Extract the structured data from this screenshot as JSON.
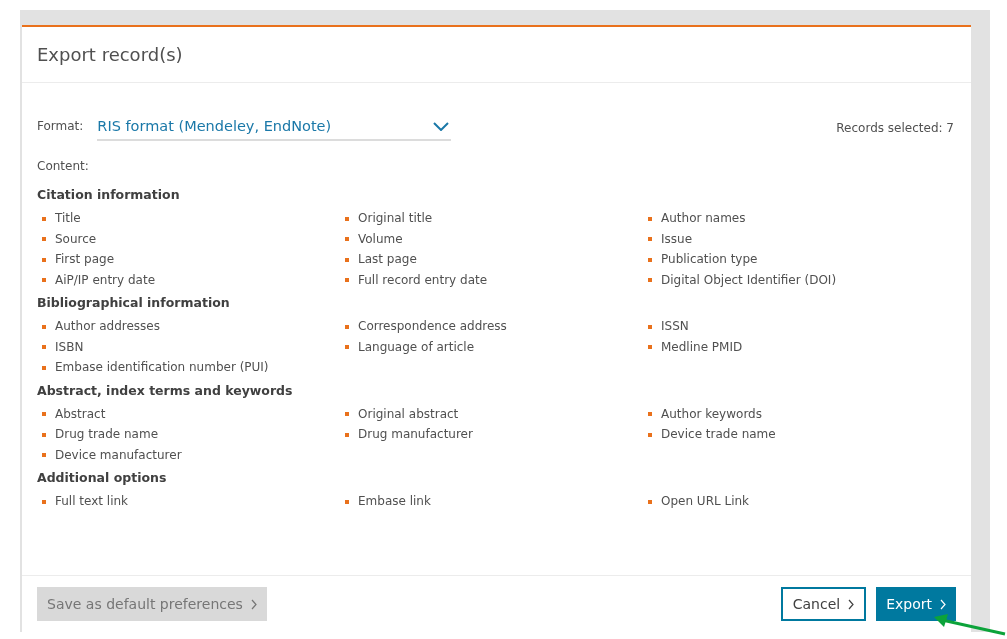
{
  "dialog": {
    "title": "Export record(s)",
    "format_label": "Format:",
    "format_value": "RIS format (Mendeley, EndNote)",
    "records_selected": "Records selected: 7",
    "content_label": "Content:",
    "sections": [
      {
        "heading": "Citation information",
        "items": [
          "Title",
          "Original title",
          "Author names",
          "Source",
          "Volume",
          "Issue",
          "First page",
          "Last page",
          "Publication type",
          "AiP/IP entry date",
          "Full record entry date",
          "Digital Object Identifier (DOI)"
        ]
      },
      {
        "heading": "Bibliographical information",
        "items": [
          "Author addresses",
          "Correspondence address",
          "ISSN",
          "ISBN",
          "Language of article",
          "Medline PMID",
          "Embase identification number (PUI)"
        ]
      },
      {
        "heading": "Abstract, index terms and keywords",
        "items": [
          "Abstract",
          "Original abstract",
          "Author keywords",
          "Drug trade name",
          "Drug manufacturer",
          "Device trade name",
          "Device manufacturer"
        ]
      },
      {
        "heading": "Additional options",
        "items": [
          "Full text link",
          "Embase link",
          "Open URL Link"
        ]
      }
    ],
    "buttons": [
      {
        "label": "Save as default preferences",
        "kind": "secondary",
        "disabled": true
      },
      {
        "label": "Cancel",
        "kind": "outline",
        "disabled": false
      },
      {
        "label": "Export",
        "kind": "primary",
        "disabled": false
      }
    ]
  }
}
